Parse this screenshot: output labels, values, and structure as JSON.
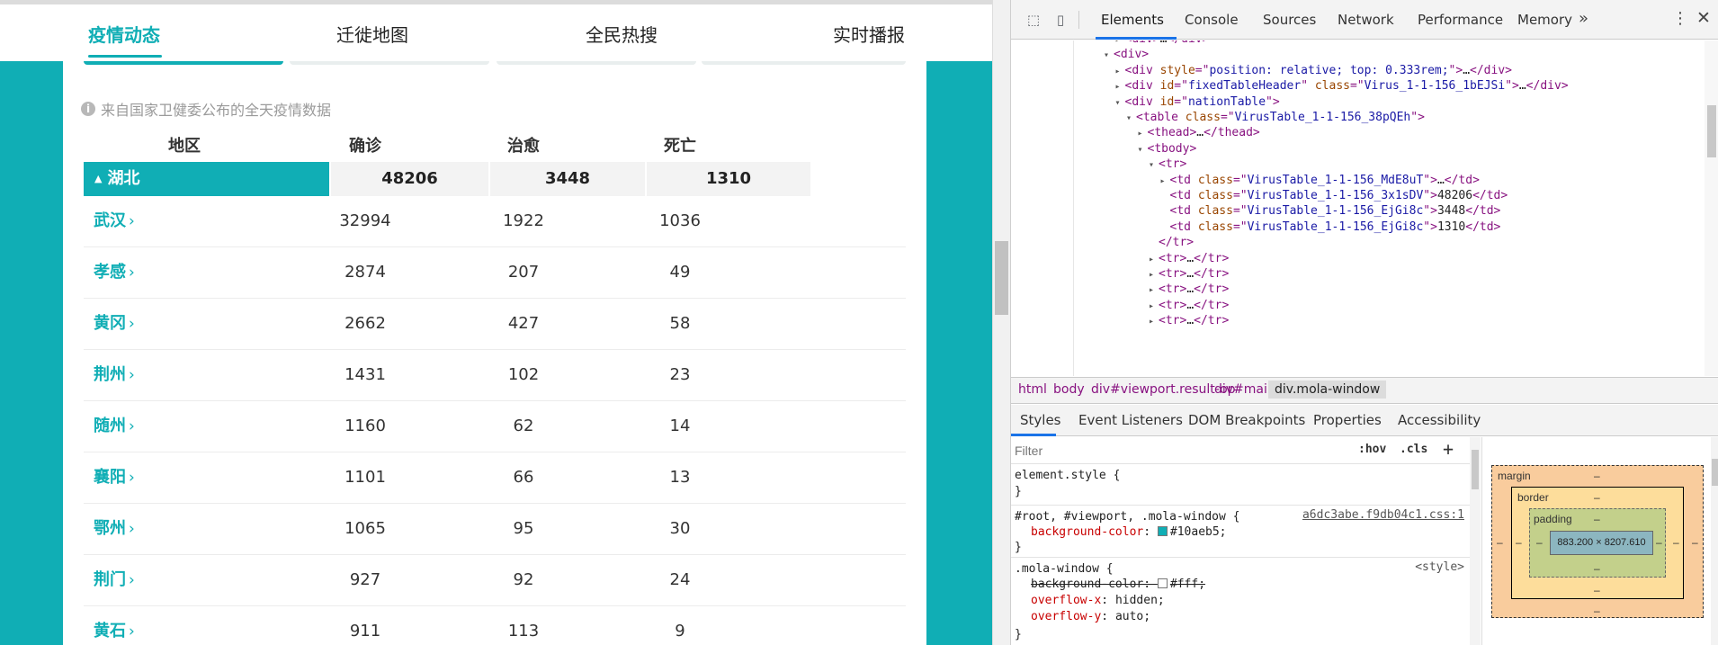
{
  "nav": {
    "tabs": [
      "疫情动态",
      "迁徙地图",
      "全民热搜",
      "实时播报"
    ]
  },
  "source_note": "来自国家卫健委公布的全天疫情数据",
  "table": {
    "headers": [
      "地区",
      "确诊",
      "治愈",
      "死亡"
    ],
    "province": {
      "name": "湖北",
      "confirmed": "48206",
      "cured": "3448",
      "dead": "1310"
    },
    "rows": [
      {
        "name": "武汉",
        "confirmed": "32994",
        "cured": "1922",
        "dead": "1036"
      },
      {
        "name": "孝感",
        "confirmed": "2874",
        "cured": "207",
        "dead": "49"
      },
      {
        "name": "黄冈",
        "confirmed": "2662",
        "cured": "427",
        "dead": "58"
      },
      {
        "name": "荆州",
        "confirmed": "1431",
        "cured": "102",
        "dead": "23"
      },
      {
        "name": "随州",
        "confirmed": "1160",
        "cured": "62",
        "dead": "14"
      },
      {
        "name": "襄阳",
        "confirmed": "1101",
        "cured": "66",
        "dead": "13"
      },
      {
        "name": "鄂州",
        "confirmed": "1065",
        "cured": "95",
        "dead": "30"
      },
      {
        "name": "荆门",
        "confirmed": "927",
        "cured": "92",
        "dead": "24"
      },
      {
        "name": "黄石",
        "confirmed": "911",
        "cured": "113",
        "dead": "9"
      }
    ]
  },
  "colors": {
    "accent": "#10aeb5",
    "devtools_accent": "#1a73e8"
  },
  "devtools": {
    "tabs": [
      "Elements",
      "Console",
      "Sources",
      "Network",
      "Performance",
      "Memory"
    ],
    "more": "»",
    "dom_lines": [
      {
        "ind": 1,
        "arrow": "▸",
        "html": "<span class='tg'>&lt;div&gt;</span><span class='tx'>…</span><span class='tg'>&lt;/div&gt;</span>"
      },
      {
        "ind": 0,
        "arrow": "▾",
        "html": "<span class='tg'>&lt;div&gt;</span>"
      },
      {
        "ind": 1,
        "arrow": "▸",
        "html": "<span class='tg'>&lt;div </span><span class='an'>style</span><span class='tg'>=\"</span><span class='av'>position: relative; top: 0.333rem;</span><span class='tg'>\"&gt;</span><span class='tx'>…</span><span class='tg'>&lt;/div&gt;</span>"
      },
      {
        "ind": 1,
        "arrow": "▸",
        "html": "<span class='tg'>&lt;div </span><span class='an'>id</span><span class='tg'>=\"</span><span class='av'>fixedTableHeader</span><span class='tg'>\" </span><span class='an'>class</span><span class='tg'>=\"</span><span class='av'>Virus_1-1-156_1bEJSi</span><span class='tg'>\"&gt;</span><span class='tx'>…</span><span class='tg'>&lt;/div&gt;</span>"
      },
      {
        "ind": 1,
        "arrow": "▾",
        "html": "<span class='tg'>&lt;div </span><span class='an'>id</span><span class='tg'>=\"</span><span class='av'>nationTable</span><span class='tg'>\"&gt;</span>"
      },
      {
        "ind": 2,
        "arrow": "▾",
        "html": "<span class='tg'>&lt;table </span><span class='an'>class</span><span class='tg'>=\"</span><span class='av'>VirusTable_1-1-156_38pQEh</span><span class='tg'>\"&gt;</span>"
      },
      {
        "ind": 3,
        "arrow": "▸",
        "html": "<span class='tg'>&lt;thead&gt;</span><span class='tx'>…</span><span class='tg'>&lt;/thead&gt;</span>"
      },
      {
        "ind": 3,
        "arrow": "▾",
        "html": "<span class='tg'>&lt;tbody&gt;</span>"
      },
      {
        "ind": 4,
        "arrow": "▾",
        "html": "<span class='tg'>&lt;tr&gt;</span>"
      },
      {
        "ind": 5,
        "arrow": "▸",
        "html": "<span class='tg'>&lt;td </span><span class='an'>class</span><span class='tg'>=\"</span><span class='av'>VirusTable_1-1-156_MdE8uT</span><span class='tg'>\"&gt;</span><span class='tx'>…</span><span class='tg'>&lt;/td&gt;</span>"
      },
      {
        "ind": 5,
        "arrow": "",
        "html": "<span class='tg'>&lt;td </span><span class='an'>class</span><span class='tg'>=\"</span><span class='av'>VirusTable_1-1-156_3x1sDV</span><span class='tg'>\"&gt;</span><span class='tx'>48206</span><span class='tg'>&lt;/td&gt;</span>"
      },
      {
        "ind": 5,
        "arrow": "",
        "html": "<span class='tg'>&lt;td </span><span class='an'>class</span><span class='tg'>=\"</span><span class='av'>VirusTable_1-1-156_EjGi8c</span><span class='tg'>\"&gt;</span><span class='tx'>3448</span><span class='tg'>&lt;/td&gt;</span>"
      },
      {
        "ind": 5,
        "arrow": "",
        "html": "<span class='tg'>&lt;td </span><span class='an'>class</span><span class='tg'>=\"</span><span class='av'>VirusTable_1-1-156_EjGi8c</span><span class='tg'>\"&gt;</span><span class='tx'>1310</span><span class='tg'>&lt;/td&gt;</span>"
      },
      {
        "ind": 4,
        "arrow": "",
        "html": "<span class='tg'>&lt;/tr&gt;</span>"
      },
      {
        "ind": 4,
        "arrow": "▸",
        "html": "<span class='tg'>&lt;tr&gt;</span><span class='tx'>…</span><span class='tg'>&lt;/tr&gt;</span>"
      },
      {
        "ind": 4,
        "arrow": "▸",
        "html": "<span class='tg'>&lt;tr&gt;</span><span class='tx'>…</span><span class='tg'>&lt;/tr&gt;</span>"
      },
      {
        "ind": 4,
        "arrow": "▸",
        "html": "<span class='tg'>&lt;tr&gt;</span><span class='tx'>…</span><span class='tg'>&lt;/tr&gt;</span>"
      },
      {
        "ind": 4,
        "arrow": "▸",
        "html": "<span class='tg'>&lt;tr&gt;</span><span class='tx'>…</span><span class='tg'>&lt;/tr&gt;</span>"
      },
      {
        "ind": 4,
        "arrow": "▸",
        "html": "<span class='tg'>&lt;tr&gt;</span><span class='tx'>…</span><span class='tg'>&lt;/tr&gt;</span>"
      }
    ],
    "breadcrumbs": [
      "html",
      "body",
      "div#viewport.result-op",
      "div#main",
      "div.mola-window"
    ],
    "sub_tabs": [
      "Styles",
      "Event Listeners",
      "DOM Breakpoints",
      "Properties",
      "Accessibility"
    ],
    "filter_placeholder": "Filter",
    "hov": ":hov",
    "cls": ".cls",
    "plus": "+",
    "rules": {
      "element_style": "element.style {",
      "close": "}",
      "root_selector": "#root, #viewport, .mola-window {",
      "root_source": "a6dc3abe.f9db04c1.css:1",
      "bg_prop": "background-color",
      "bg_value": "#10aeb5;",
      "mola_selector": ".mola-window {",
      "mola_source": "<style>",
      "struck_prop": "background-color: ",
      "struck_value": "#fff;",
      "ox": "overflow-x",
      "ox_value": "hidden;",
      "oy": "overflow-y",
      "oy_value": "auto;"
    },
    "box_model": {
      "margin_label": "margin",
      "border_label": "border",
      "padding_label": "padding",
      "dash": "–",
      "content_size": "883.200 × 8207.610"
    }
  }
}
